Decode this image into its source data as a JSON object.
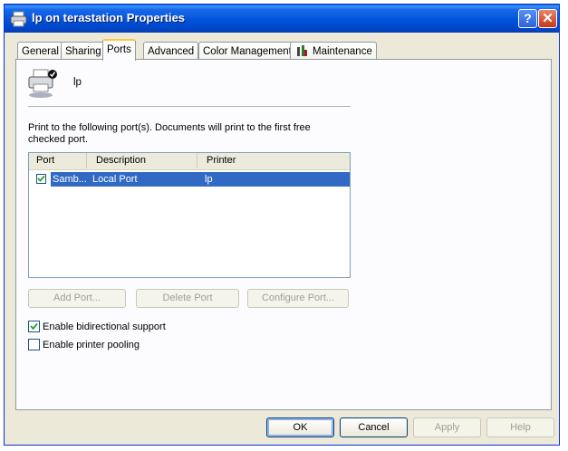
{
  "window": {
    "title": "lp on terastation Properties"
  },
  "tabs": [
    {
      "label": "General"
    },
    {
      "label": "Sharing"
    },
    {
      "label": "Ports"
    },
    {
      "label": "Advanced"
    },
    {
      "label": "Color Management"
    },
    {
      "label": "Maintenance"
    }
  ],
  "active_tab": "Ports",
  "printer": {
    "name": "lp"
  },
  "ports_page": {
    "description": "Print to the following port(s). Documents will print to the first free checked port.",
    "columns": [
      "Port",
      "Description",
      "Printer"
    ],
    "rows": [
      {
        "port": "Samb...",
        "description": "Local Port",
        "printer": "lp",
        "checked": true,
        "selected": true
      }
    ],
    "buttons": {
      "add": "Add Port...",
      "delete": "Delete Port",
      "configure": "Configure Port..."
    },
    "enable_bidirectional": {
      "label": "Enable bidirectional support",
      "checked": true
    },
    "enable_pooling": {
      "label": "Enable printer pooling",
      "checked": false
    }
  },
  "dialog_buttons": {
    "ok": "OK",
    "cancel": "Cancel",
    "apply": "Apply",
    "help": "Help"
  },
  "colors": {
    "titlebar": "#0054e3",
    "selection": "#316ac5",
    "tab_highlight": "#ffc73c"
  }
}
